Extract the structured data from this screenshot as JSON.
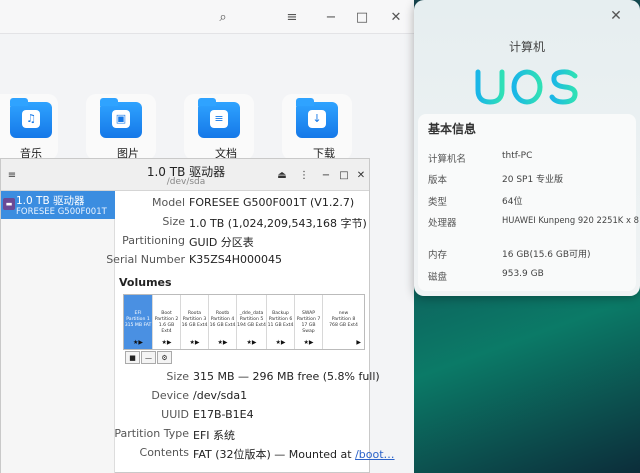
{
  "file_manager": {
    "items": [
      {
        "label": "音乐",
        "icon": "music-icon",
        "glyph": "♫"
      },
      {
        "label": "图片",
        "icon": "picture-icon",
        "glyph": "▣"
      },
      {
        "label": "文档",
        "icon": "document-icon",
        "glyph": "≡"
      },
      {
        "label": "下载",
        "icon": "download-icon",
        "glyph": "↓"
      }
    ]
  },
  "about": {
    "title": "计算机",
    "logo": "UOS",
    "section": "基本信息",
    "rows": [
      {
        "key": "计算机名",
        "value": "thtf-PC"
      },
      {
        "key": "版本",
        "value": "20 SP1 专业版"
      },
      {
        "key": "类型",
        "value": "64位"
      },
      {
        "key": "处理器",
        "value": "HUAWEI Kunpeng 920 2251K x 8"
      },
      {
        "key": "内存",
        "value": "16 GB(15.6 GB可用)"
      },
      {
        "key": "磁盘",
        "value": "953.9 GB"
      }
    ]
  },
  "disk": {
    "title": "1.0 TB 驱动器",
    "subtitle": "/dev/sda",
    "drive": {
      "name": "1.0 TB 驱动器",
      "model": "FORESEE G500F001T"
    },
    "props": [
      {
        "key": "Model",
        "value": "FORESEE G500F001T (V1.2.7)"
      },
      {
        "key": "Size",
        "value": "1.0 TB (1,024,209,543,168 字节)"
      },
      {
        "key": "Partitioning",
        "value": "GUID 分区表"
      },
      {
        "key": "Serial Number",
        "value": "K35ZS4H000045"
      }
    ],
    "volumes_label": "Volumes",
    "partitions": [
      {
        "lines": [
          "EFI",
          "Partition 1",
          "315 MB FAT"
        ],
        "icons": "★▶"
      },
      {
        "lines": [
          "Boot",
          "Partition 2",
          "1.6 GB Ext4"
        ],
        "icons": "★▶"
      },
      {
        "lines": [
          "Roota",
          "Partition 3",
          "16 GB Ext4"
        ],
        "icons": "★▶"
      },
      {
        "lines": [
          "Rootb",
          "Partition 4",
          "16 GB Ext4"
        ],
        "icons": "★▶"
      },
      {
        "lines": [
          "_dde_data",
          "Partition 5",
          "194 GB Ext4"
        ],
        "icons": "★▶"
      },
      {
        "lines": [
          "Backup",
          "Partition 6",
          "11 GB Ext4"
        ],
        "icons": "★▶"
      },
      {
        "lines": [
          "SWAP",
          "Partition 7",
          "17 GB Swap"
        ],
        "icons": "★▶"
      },
      {
        "lines": [
          "new",
          "Partition 8",
          "768 GB Ext4"
        ],
        "icons": "▶"
      }
    ],
    "volume": [
      {
        "key": "Size",
        "value": "315 MB — 296 MB free (5.8% full)"
      },
      {
        "key": "Device",
        "value": "/dev/sda1"
      },
      {
        "key": "UUID",
        "value": "E17B-B1E4"
      },
      {
        "key": "Partition Type",
        "value": "EFI 系统"
      },
      {
        "key": "Contents",
        "value": "FAT (32位版本) — Mounted at ",
        "link": "/boot…"
      }
    ]
  }
}
